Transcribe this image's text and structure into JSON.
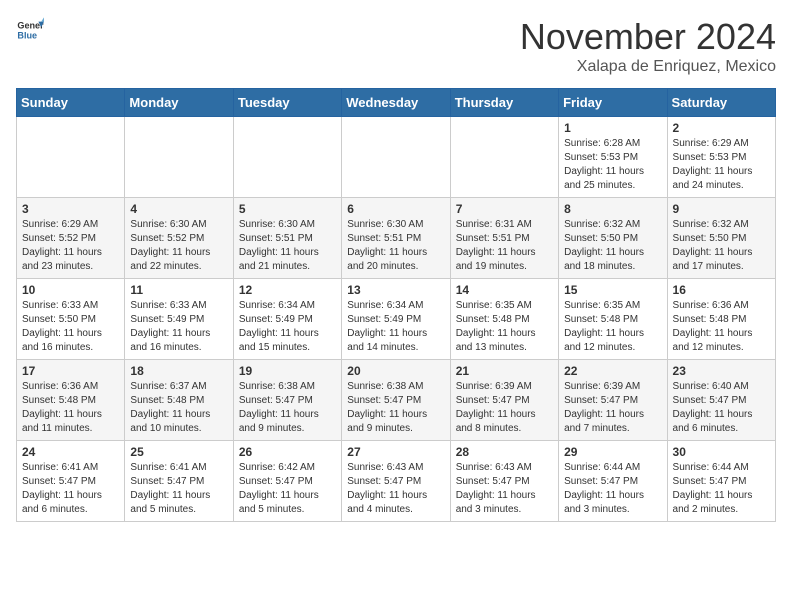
{
  "header": {
    "logo_general": "General",
    "logo_blue": "Blue",
    "month": "November 2024",
    "location": "Xalapa de Enriquez, Mexico"
  },
  "weekdays": [
    "Sunday",
    "Monday",
    "Tuesday",
    "Wednesday",
    "Thursday",
    "Friday",
    "Saturday"
  ],
  "weeks": [
    [
      {
        "day": "",
        "info": ""
      },
      {
        "day": "",
        "info": ""
      },
      {
        "day": "",
        "info": ""
      },
      {
        "day": "",
        "info": ""
      },
      {
        "day": "",
        "info": ""
      },
      {
        "day": "1",
        "info": "Sunrise: 6:28 AM\nSunset: 5:53 PM\nDaylight: 11 hours and 25 minutes."
      },
      {
        "day": "2",
        "info": "Sunrise: 6:29 AM\nSunset: 5:53 PM\nDaylight: 11 hours and 24 minutes."
      }
    ],
    [
      {
        "day": "3",
        "info": "Sunrise: 6:29 AM\nSunset: 5:52 PM\nDaylight: 11 hours and 23 minutes."
      },
      {
        "day": "4",
        "info": "Sunrise: 6:30 AM\nSunset: 5:52 PM\nDaylight: 11 hours and 22 minutes."
      },
      {
        "day": "5",
        "info": "Sunrise: 6:30 AM\nSunset: 5:51 PM\nDaylight: 11 hours and 21 minutes."
      },
      {
        "day": "6",
        "info": "Sunrise: 6:30 AM\nSunset: 5:51 PM\nDaylight: 11 hours and 20 minutes."
      },
      {
        "day": "7",
        "info": "Sunrise: 6:31 AM\nSunset: 5:51 PM\nDaylight: 11 hours and 19 minutes."
      },
      {
        "day": "8",
        "info": "Sunrise: 6:32 AM\nSunset: 5:50 PM\nDaylight: 11 hours and 18 minutes."
      },
      {
        "day": "9",
        "info": "Sunrise: 6:32 AM\nSunset: 5:50 PM\nDaylight: 11 hours and 17 minutes."
      }
    ],
    [
      {
        "day": "10",
        "info": "Sunrise: 6:33 AM\nSunset: 5:50 PM\nDaylight: 11 hours and 16 minutes."
      },
      {
        "day": "11",
        "info": "Sunrise: 6:33 AM\nSunset: 5:49 PM\nDaylight: 11 hours and 16 minutes."
      },
      {
        "day": "12",
        "info": "Sunrise: 6:34 AM\nSunset: 5:49 PM\nDaylight: 11 hours and 15 minutes."
      },
      {
        "day": "13",
        "info": "Sunrise: 6:34 AM\nSunset: 5:49 PM\nDaylight: 11 hours and 14 minutes."
      },
      {
        "day": "14",
        "info": "Sunrise: 6:35 AM\nSunset: 5:48 PM\nDaylight: 11 hours and 13 minutes."
      },
      {
        "day": "15",
        "info": "Sunrise: 6:35 AM\nSunset: 5:48 PM\nDaylight: 11 hours and 12 minutes."
      },
      {
        "day": "16",
        "info": "Sunrise: 6:36 AM\nSunset: 5:48 PM\nDaylight: 11 hours and 12 minutes."
      }
    ],
    [
      {
        "day": "17",
        "info": "Sunrise: 6:36 AM\nSunset: 5:48 PM\nDaylight: 11 hours and 11 minutes."
      },
      {
        "day": "18",
        "info": "Sunrise: 6:37 AM\nSunset: 5:48 PM\nDaylight: 11 hours and 10 minutes."
      },
      {
        "day": "19",
        "info": "Sunrise: 6:38 AM\nSunset: 5:47 PM\nDaylight: 11 hours and 9 minutes."
      },
      {
        "day": "20",
        "info": "Sunrise: 6:38 AM\nSunset: 5:47 PM\nDaylight: 11 hours and 9 minutes."
      },
      {
        "day": "21",
        "info": "Sunrise: 6:39 AM\nSunset: 5:47 PM\nDaylight: 11 hours and 8 minutes."
      },
      {
        "day": "22",
        "info": "Sunrise: 6:39 AM\nSunset: 5:47 PM\nDaylight: 11 hours and 7 minutes."
      },
      {
        "day": "23",
        "info": "Sunrise: 6:40 AM\nSunset: 5:47 PM\nDaylight: 11 hours and 6 minutes."
      }
    ],
    [
      {
        "day": "24",
        "info": "Sunrise: 6:41 AM\nSunset: 5:47 PM\nDaylight: 11 hours and 6 minutes."
      },
      {
        "day": "25",
        "info": "Sunrise: 6:41 AM\nSunset: 5:47 PM\nDaylight: 11 hours and 5 minutes."
      },
      {
        "day": "26",
        "info": "Sunrise: 6:42 AM\nSunset: 5:47 PM\nDaylight: 11 hours and 5 minutes."
      },
      {
        "day": "27",
        "info": "Sunrise: 6:43 AM\nSunset: 5:47 PM\nDaylight: 11 hours and 4 minutes."
      },
      {
        "day": "28",
        "info": "Sunrise: 6:43 AM\nSunset: 5:47 PM\nDaylight: 11 hours and 3 minutes."
      },
      {
        "day": "29",
        "info": "Sunrise: 6:44 AM\nSunset: 5:47 PM\nDaylight: 11 hours and 3 minutes."
      },
      {
        "day": "30",
        "info": "Sunrise: 6:44 AM\nSunset: 5:47 PM\nDaylight: 11 hours and 2 minutes."
      }
    ]
  ]
}
